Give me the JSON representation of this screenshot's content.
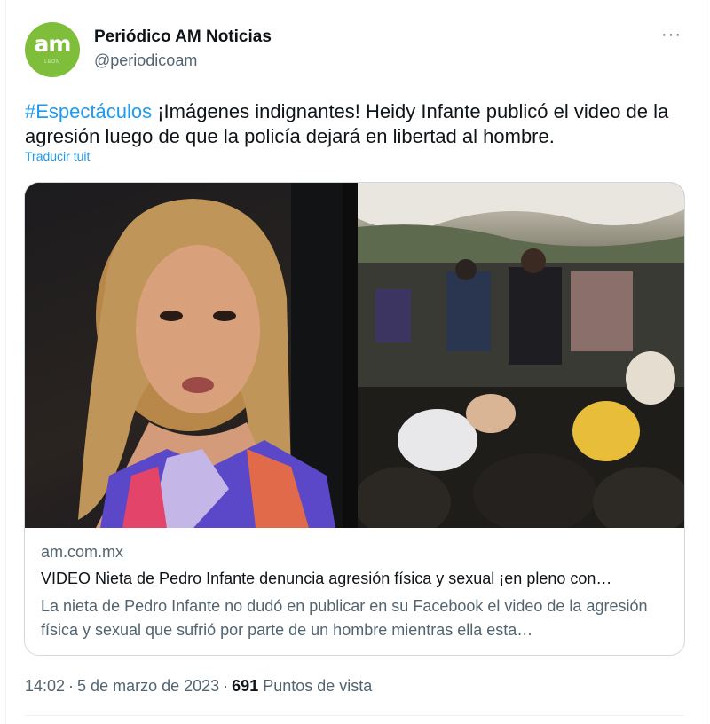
{
  "tweet": {
    "author_name": "Periódico AM Noticias",
    "author_handle": "@periodicoam",
    "avatar_text": "am",
    "avatar_sub": "LEÓN",
    "more_label": "···",
    "hashtag": "#Espectáculos",
    "body": " ¡Imágenes indignantes! Heidy Infante publicó el video de la agresión luego de que la policía dejará en libertad al hombre.",
    "translate_label": "Traducir tuit",
    "time": "14:02",
    "date": "5 de marzo de 2023",
    "separator": "·",
    "views_count": "691",
    "views_label": "Puntos de vista"
  },
  "card": {
    "domain": "am.com.mx",
    "title": "VIDEO Nieta de Pedro Infante denuncia agresión física y sexual ¡en pleno con…",
    "description": "La nieta de Pedro Infante no dudó en publicar en su Facebook el video de la agresión física y sexual que sufrió por parte de un hombre mientras ella esta…"
  },
  "colors": {
    "accent": "#1d9bf0",
    "avatar_bg": "#7fbe3a",
    "secondary_text": "#536471",
    "border": "#cfd9de"
  }
}
